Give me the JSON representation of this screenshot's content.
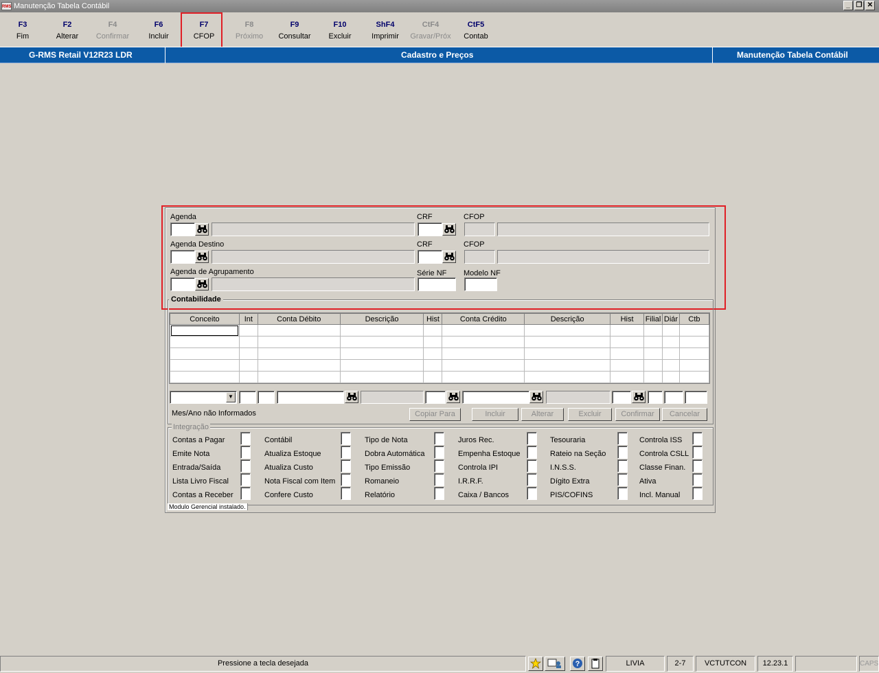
{
  "window": {
    "title": "Manutenção Tabela Contábil",
    "logo_text": "RMS",
    "minimize": "_",
    "restore": "❐",
    "close": "✕"
  },
  "function_keys": [
    {
      "key": "F3",
      "label": "Fim",
      "enabled": true
    },
    {
      "key": "F2",
      "label": "Alterar",
      "enabled": true
    },
    {
      "key": "F4",
      "label": "Confirmar",
      "enabled": false
    },
    {
      "key": "F6",
      "label": "Incluir",
      "enabled": true
    },
    {
      "key": "F7",
      "label": "CFOP",
      "enabled": true
    },
    {
      "key": "F8",
      "label": "Próximo",
      "enabled": false
    },
    {
      "key": "F9",
      "label": "Consultar",
      "enabled": true
    },
    {
      "key": "F10",
      "label": "Excluir",
      "enabled": true
    },
    {
      "key": "ShF4",
      "label": "Imprimir",
      "enabled": true
    },
    {
      "key": "CtF4",
      "label": "Gravar/Próx",
      "enabled": false
    },
    {
      "key": "CtF5",
      "label": "Contab",
      "enabled": true
    }
  ],
  "header": {
    "product": "G-RMS Retail V12R23 LDR",
    "module": "Cadastro e Preços",
    "screen": "Manutenção Tabela Contábil"
  },
  "form": {
    "agenda": "Agenda",
    "crf": "CRF",
    "cfop": "CFOP",
    "agenda_destino": "Agenda Destino",
    "agenda_agrupamento": "Agenda de Agrupamento",
    "serie_nf": "Série NF",
    "modelo_nf": "Modelo NF"
  },
  "contabilidade": {
    "title": "Contabilidade",
    "columns": [
      "Conceito",
      "Int",
      "Conta Débito",
      "Descrição",
      "Hist",
      "Conta Crédito",
      "Descrição",
      "Hist",
      "Filial",
      "Diár",
      "Ctb"
    ],
    "rows": 5,
    "status": "Mes/Ano não Informados",
    "buttons": [
      "Copiar Para",
      "Incluir",
      "Alterar",
      "Excluir",
      "Confirmar",
      "Cancelar"
    ]
  },
  "integracao": {
    "title": "Integração",
    "columns": [
      [
        "Contas a Pagar",
        "Emite Nota",
        "Entrada/Saída",
        "Lista Livro Fiscal",
        "Contas a Receber"
      ],
      [
        "Contábil",
        "Atualiza Estoque",
        "Atualiza Custo",
        "Nota Fiscal com Item",
        "Confere Custo"
      ],
      [
        "Tipo de Nota",
        "Dobra Automática",
        "Tipo Emissão",
        "Romaneio",
        "Relatório"
      ],
      [
        "Juros Rec.",
        "Empenha Estoque",
        "Controla IPI",
        "I.R.R.F.",
        "Caixa / Bancos"
      ],
      [
        "Tesouraria",
        "Rateio na Seção",
        "I.N.S.S.",
        "Dígito Extra",
        "PIS/COFINS"
      ],
      [
        "Controla ISS",
        "Controla CSLL",
        "Classe Finan.",
        "Ativa",
        "Incl. Manual"
      ]
    ],
    "footer": "Modulo Gerencial instalado."
  },
  "statusbar": {
    "message": "Pressione a tecla desejada",
    "user": "LIVIA",
    "page": "2-7",
    "program": "VCTUTCON",
    "version": "12.23.1",
    "caps": "CAPS"
  },
  "icons": {
    "binoculars": "binoculars-icon",
    "dropdown": "chevron-down-icon"
  },
  "colors": {
    "header_blue": "#0c5aa6",
    "highlight_red": "#e01e25",
    "fkey_blue": "#00006a"
  }
}
